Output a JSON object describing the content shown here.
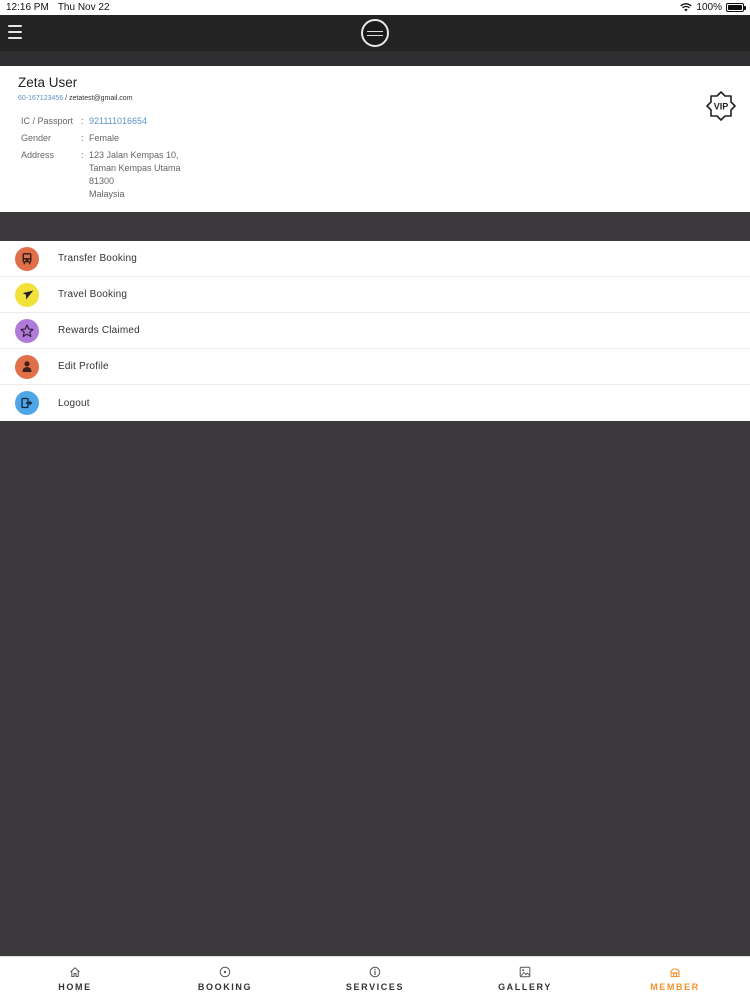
{
  "status_bar": {
    "time": "12:16 PM",
    "date": "Thu Nov 22",
    "battery": "100%",
    "battery_level": 1.0
  },
  "profile": {
    "name": "Zeta User",
    "phone": "60-167123456",
    "separator": "/",
    "email": "zetatest@gmail.com",
    "fields": {
      "ic_label": "IC / Passport",
      "ic_value": "921111016654",
      "gender_label": "Gender",
      "gender_value": "Female",
      "address_label": "Address",
      "address_lines": [
        "123 Jalan Kempas 10,",
        "Taman Kempas Utama",
        "81300",
        "Malaysia"
      ]
    },
    "colon": ":",
    "badge": "VIP"
  },
  "menu": {
    "items": [
      {
        "label": "Transfer Booking",
        "icon": "bus-icon",
        "color": "#e0704a"
      },
      {
        "label": "Travel Booking",
        "icon": "airplane-icon",
        "color": "#f2e13a"
      },
      {
        "label": "Rewards Claimed",
        "icon": "star-icon",
        "color": "#b07ad8"
      },
      {
        "label": "Edit Profile",
        "icon": "user-icon",
        "color": "#e0704a"
      },
      {
        "label": "Logout",
        "icon": "logout-icon",
        "color": "#4ea6e6"
      }
    ]
  },
  "tabs": [
    {
      "label": "HOME",
      "icon": "home-icon",
      "active": false
    },
    {
      "label": "BOOKING",
      "icon": "booking-icon",
      "active": false
    },
    {
      "label": "SERVICES",
      "icon": "info-icon",
      "active": false
    },
    {
      "label": "GALLERY",
      "icon": "gallery-icon",
      "active": false
    },
    {
      "label": "MEMBER",
      "icon": "member-icon",
      "active": true
    }
  ],
  "colors": {
    "accent": "#f0932e",
    "link": "#5b93c9",
    "nav_bg": "#232323",
    "page_bg": "#3b393c"
  }
}
